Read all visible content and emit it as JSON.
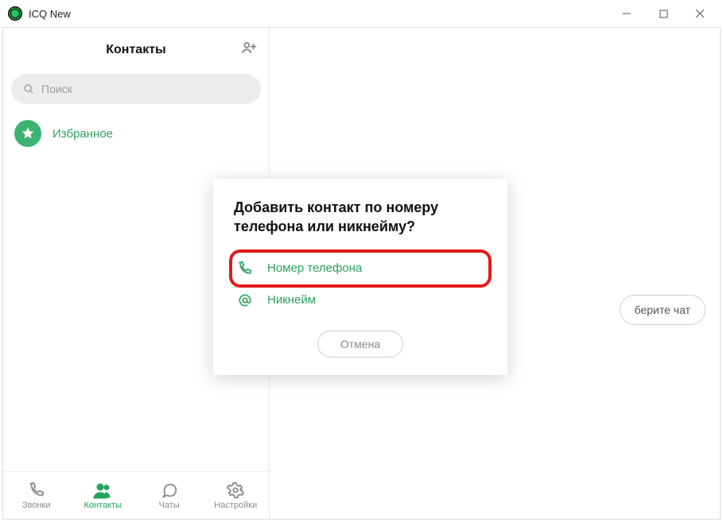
{
  "titlebar": {
    "app_title": "ICQ New"
  },
  "sidebar": {
    "title": "Контакты",
    "search_placeholder": "Поиск",
    "favorites_label": "Избранное"
  },
  "nav": {
    "calls": "Звонки",
    "contacts": "Контакты",
    "chats": "Чаты",
    "settings": "Настройки"
  },
  "main": {
    "chip_hint": "берите чат"
  },
  "modal": {
    "title": "Добавить контакт по номеру телефона или никнейму?",
    "option_phone": "Номер телефона",
    "option_nickname": "Никнейм",
    "cancel": "Отмена"
  },
  "colors": {
    "accent": "#22a656"
  }
}
